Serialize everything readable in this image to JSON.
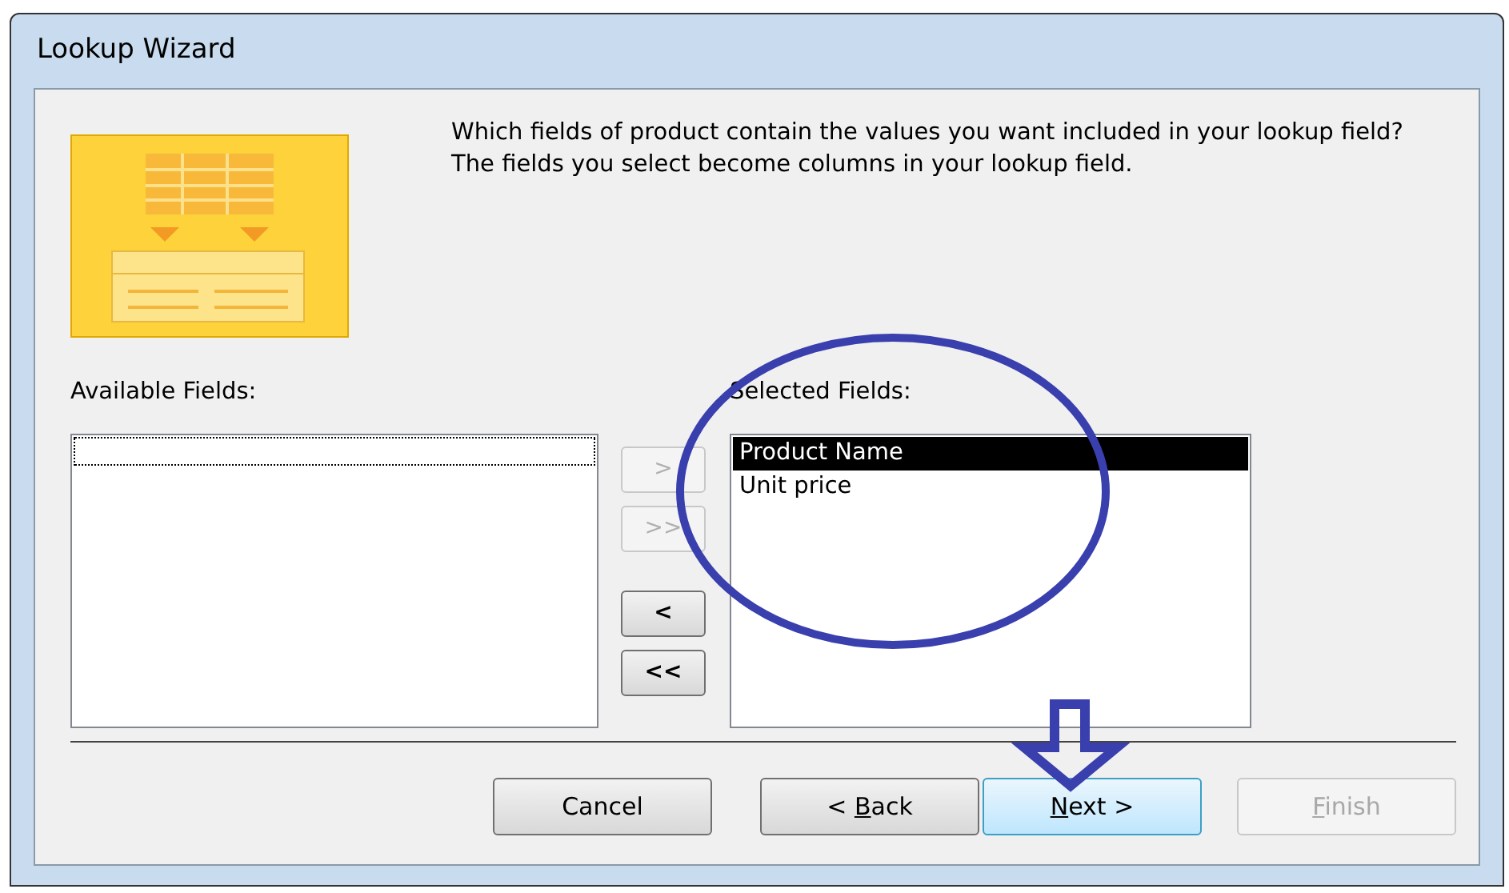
{
  "window": {
    "title": "Lookup Wizard"
  },
  "instructions": "Which fields of product contain the values you want included in your lookup field? The fields you select become columns in your lookup field.",
  "available": {
    "label": "Available Fields:"
  },
  "selected_fields": {
    "label": "Selected Fields:",
    "items": [
      {
        "label": "Product Name",
        "selected": true
      },
      {
        "label": "Unit price",
        "selected": false
      }
    ]
  },
  "move_buttons": [
    {
      "label": ">",
      "disabled": true
    },
    {
      "label": ">>",
      "disabled": true
    },
    {
      "label": "<",
      "disabled": false
    },
    {
      "label": "<<",
      "disabled": false
    }
  ],
  "buttons": [
    {
      "label": "Cancel",
      "disabled": false,
      "focused": false
    },
    {
      "before": "< ",
      "access_key": "B",
      "after": "ack",
      "disabled": false,
      "focused": false
    },
    {
      "access_key": "N",
      "after": "ext >",
      "disabled": false,
      "focused": true
    },
    {
      "access_key": "F",
      "after": "inish",
      "disabled": true,
      "focused": false
    }
  ]
}
